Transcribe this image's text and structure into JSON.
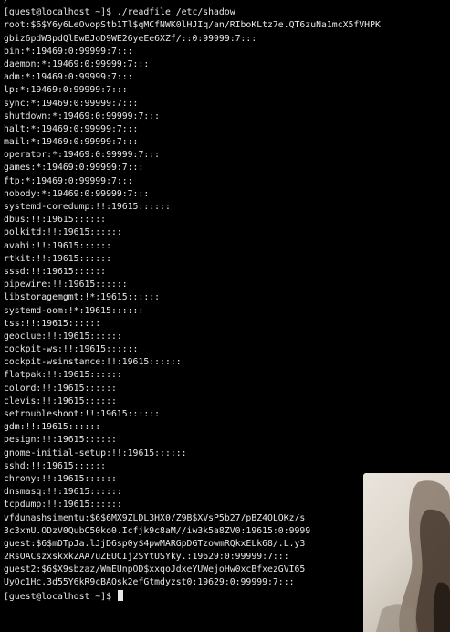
{
  "terminal": {
    "lines": [
      "/",
      "[guest@localhost ~]$ ./readfile /etc/shadow",
      "root:$6$Y6y6LeOvopStb1Tl$qMCfNWK0lHJIq/an/RIboKLtz7e.QT6zuNa1mcX5fVHPK",
      "gbiz6pdW3pdQlEwBJoD9WE26yeEe6XZf/::0:99999:7:::",
      "bin:*:19469:0:99999:7:::",
      "daemon:*:19469:0:99999:7:::",
      "adm:*:19469:0:99999:7:::",
      "lp:*:19469:0:99999:7:::",
      "sync:*:19469:0:99999:7:::",
      "shutdown:*:19469:0:99999:7:::",
      "halt:*:19469:0:99999:7:::",
      "mail:*:19469:0:99999:7:::",
      "operator:*:19469:0:99999:7:::",
      "games:*:19469:0:99999:7:::",
      "ftp:*:19469:0:99999:7:::",
      "nobody:*:19469:0:99999:7:::",
      "systemd-coredump:!!:19615::::::",
      "dbus:!!:19615::::::",
      "polkitd:!!:19615::::::",
      "avahi:!!:19615::::::",
      "rtkit:!!:19615::::::",
      "sssd:!!:19615::::::",
      "pipewire:!!:19615::::::",
      "libstoragemgmt:!*:19615::::::",
      "systemd-oom:!*:19615::::::",
      "tss:!!:19615::::::",
      "geoclue:!!:19615::::::",
      "cockpit-ws:!!:19615::::::",
      "cockpit-wsinstance:!!:19615::::::",
      "flatpak:!!:19615::::::",
      "colord:!!:19615::::::",
      "clevis:!!:19615::::::",
      "setroubleshoot:!!:19615::::::",
      "gdm:!!:19615::::::",
      "pesign:!!:19615::::::",
      "gnome-initial-setup:!!:19615::::::",
      "sshd:!!:19615::::::",
      "chrony:!!:19615::::::",
      "dnsmasq:!!:19615::::::",
      "tcpdump:!!:19615::::::",
      "vfdunashsimentu:$6$6MX9ZLDL3HX0/Z9B$XVsP5b27/pBZ4OLQKz/s",
      "3c3xmU.ODzV0QubC50ko0.Icfjk9c8aM//iw3k5a8ZV0:19615:0:9999",
      "guest:$6$mDTpJa.lJjD6sp0y$4pwMARGpDGTzowmRQkxELk68/.L.y3",
      "2RsOACszxskxkZAA7uZEUCIj2SYtUSYky.:19629:0:99999:7:::",
      "guest2:$6$X9sbzaz/WmEUnpOD$xxqoJdxeYUWejoHw0xcBfxezGVI65",
      "UyOc1Hc.3d55Y6kR9cBAQsk2efGtmdyzst0:19629:0:99999:7:::"
    ],
    "final_prompt": "[guest@localhost ~]$ "
  },
  "colors": {
    "background": "#000000",
    "foreground": "#e8e8e8"
  }
}
